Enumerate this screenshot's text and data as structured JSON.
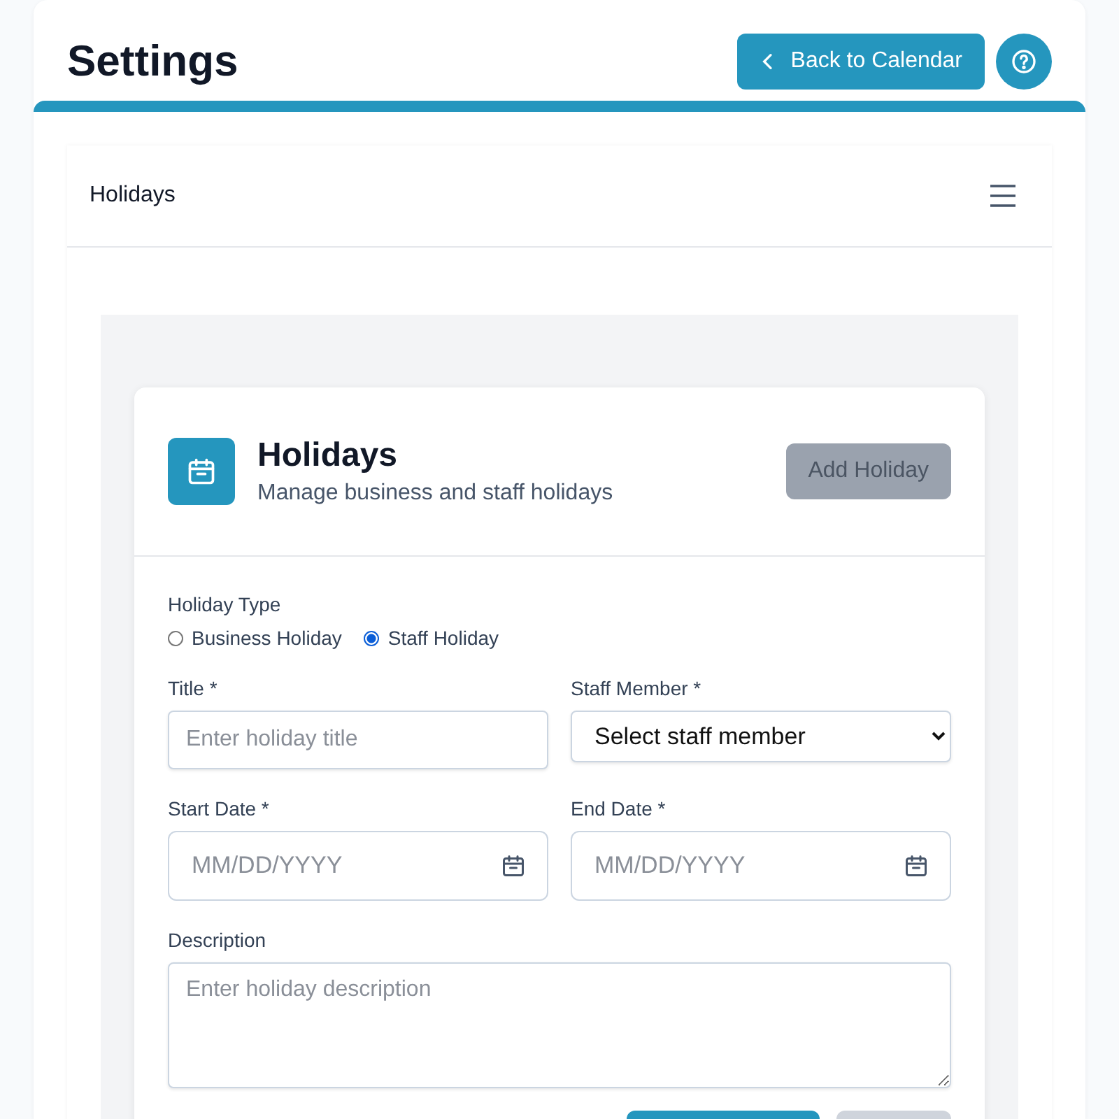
{
  "page": {
    "title": "Settings",
    "back_button": "Back to Calendar"
  },
  "section_bar": {
    "title": "Holidays"
  },
  "card": {
    "title": "Holidays",
    "subtitle": "Manage business and staff holidays",
    "add_button": {
      "label": "Add Holiday",
      "disabled": true
    }
  },
  "form": {
    "holiday_type": {
      "label": "Holiday Type",
      "options": [
        {
          "label": "Business Holiday",
          "selected": false
        },
        {
          "label": "Staff Holiday",
          "selected": true
        }
      ]
    },
    "fields": [
      {
        "kind": "text",
        "label": "Title *",
        "placeholder": "Enter holiday title"
      },
      {
        "kind": "select",
        "label": "Staff Member *",
        "value": "Select staff member"
      },
      {
        "kind": "date",
        "label": "Start Date *",
        "placeholder": "MM/DD/YYYY"
      },
      {
        "kind": "date",
        "label": "End Date *",
        "placeholder": "MM/DD/YYYY"
      },
      {
        "kind": "textarea",
        "label": "Description",
        "placeholder": "Enter holiday description"
      }
    ],
    "actions": [
      {
        "kind": "primary"
      },
      {
        "kind": "secondary"
      }
    ]
  }
}
